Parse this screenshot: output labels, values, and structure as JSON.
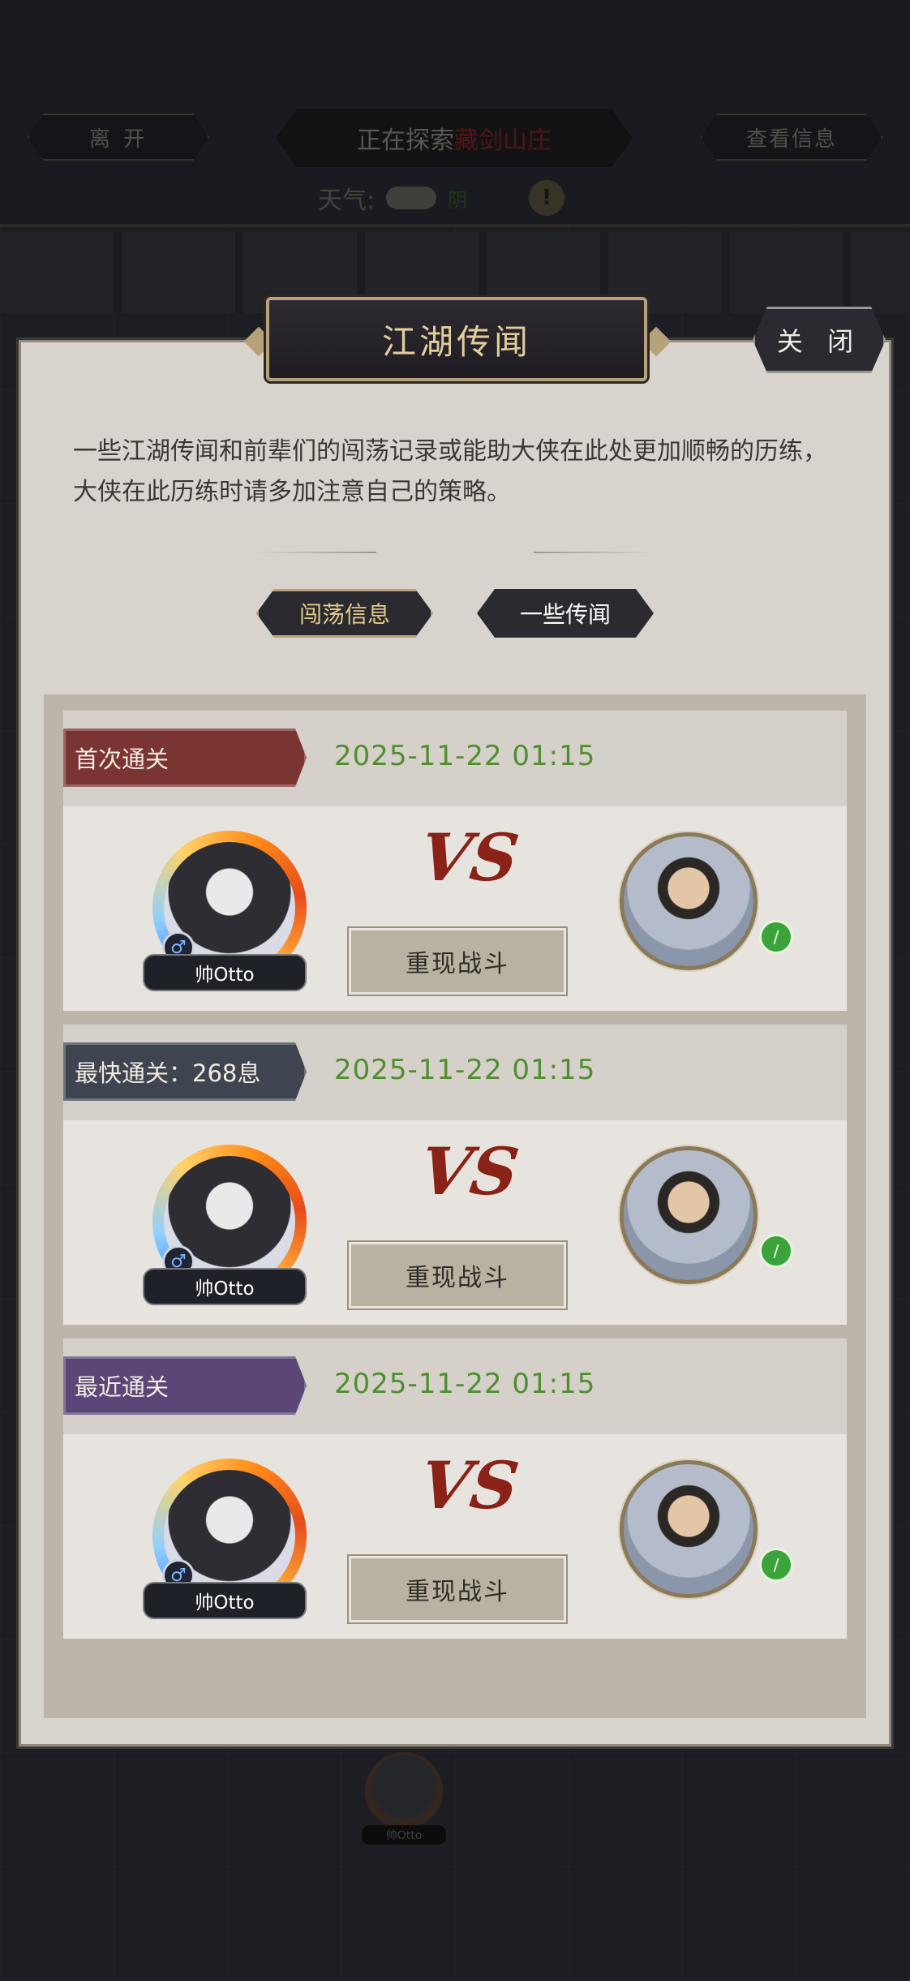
{
  "topbar": {
    "leave_label": "离 开",
    "exploring_prefix": "正在探索",
    "location": "藏剑山庄",
    "info_label": "查看信息",
    "weather_label": "天气:",
    "weather_value": "阴",
    "warn_symbol": "!"
  },
  "modal": {
    "title": "江湖传闻",
    "close_label": "关 闭",
    "description": "一些江湖传闻和前辈们的闯荡记录或能助大侠在此处更加顺畅的历练，大侠在此历练时请多加注意自己的策略。",
    "tabs": [
      {
        "label": "闯荡信息",
        "active": true
      },
      {
        "label": "一些传闻",
        "active": false
      }
    ]
  },
  "records": [
    {
      "title": "首次通关",
      "ribbon_color": "#7a3431",
      "date": "2025-11-22 01:15",
      "player_name": "帅Otto",
      "gender_icon": "♂",
      "vs": "VS",
      "replay_label": "重现战斗"
    },
    {
      "title": "最快通关：268息",
      "ribbon_color": "#3e4550",
      "date": "2025-11-22 01:15",
      "player_name": "帅Otto",
      "gender_icon": "♂",
      "vs": "VS",
      "replay_label": "重现战斗"
    },
    {
      "title": "最近通关",
      "ribbon_color": "#5a4777",
      "date": "2025-11-22 01:15",
      "player_name": "帅Otto",
      "gender_icon": "♂",
      "vs": "VS",
      "replay_label": "重现战斗"
    }
  ],
  "background": {
    "avatar_name": "帅Otto"
  }
}
